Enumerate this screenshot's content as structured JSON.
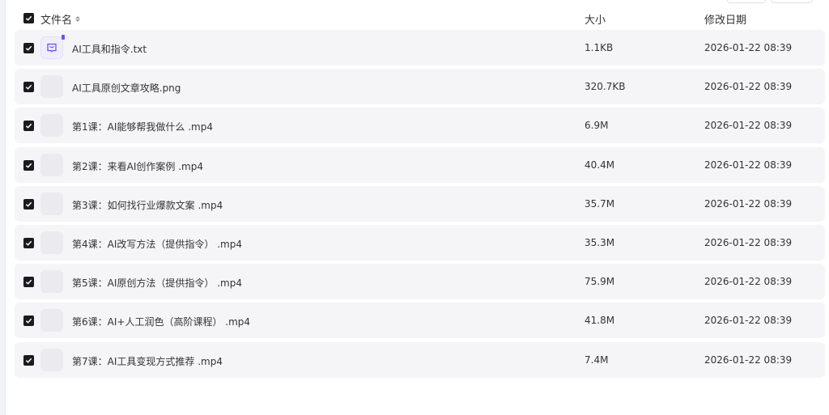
{
  "header": {
    "name_label": "文件名",
    "size_label": "大小",
    "date_label": "修改日期"
  },
  "files": [
    {
      "name": "AI工具和指令.txt",
      "size": "1.1KB",
      "date": "2026-01-22 08:39",
      "icon": "text-file-icon"
    },
    {
      "name": "AI工具原创文章攻略.png",
      "size": "320.7KB",
      "date": "2026-01-22 08:39",
      "icon": "image-thumbnail"
    },
    {
      "name": "第1课：AI能够帮我做什么 .mp4",
      "size": "6.9M",
      "date": "2026-01-22 08:39",
      "icon": "video-thumbnail"
    },
    {
      "name": "第2课：来看AI创作案例 .mp4",
      "size": "40.4M",
      "date": "2026-01-22 08:39",
      "icon": "video-thumbnail"
    },
    {
      "name": "第3课：如何找行业爆款文案 .mp4",
      "size": "35.7M",
      "date": "2026-01-22 08:39",
      "icon": "video-thumbnail"
    },
    {
      "name": "第4课：AI改写方法（提供指令） .mp4",
      "size": "35.3M",
      "date": "2026-01-22 08:39",
      "icon": "video-thumbnail"
    },
    {
      "name": "第5课：AI原创方法（提供指令） .mp4",
      "size": "75.9M",
      "date": "2026-01-22 08:39",
      "icon": "video-thumbnail"
    },
    {
      "name": "第6课：AI+人工润色（高阶课程） .mp4",
      "size": "41.8M",
      "date": "2026-01-22 08:39",
      "icon": "video-thumbnail"
    },
    {
      "name": "第7课：AI工具变现方式推荐 .mp4",
      "size": "7.4M",
      "date": "2026-01-22 08:39",
      "icon": "video-thumbnail"
    }
  ],
  "colors": {
    "row_bg": "#f5f5f7",
    "checkbox": "#1b1b1f",
    "txt_icon_accent": "#6a55e8"
  }
}
